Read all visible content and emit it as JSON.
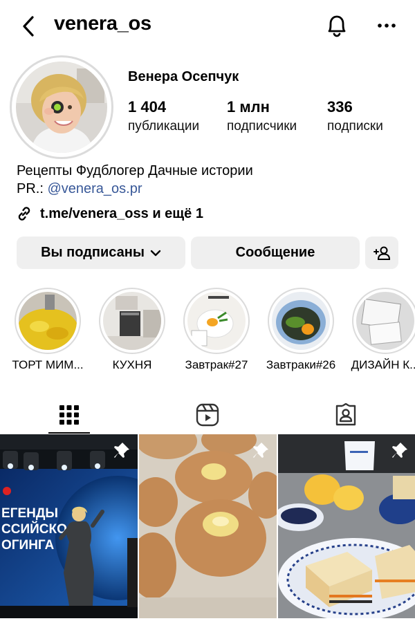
{
  "header": {
    "username": "venera_os",
    "icons": {
      "back": "chevron-left-icon",
      "notifications": "bell-icon",
      "more": "more-icon"
    }
  },
  "profile": {
    "full_name": "Венера Осепчук",
    "stats": [
      {
        "value": "1 404",
        "label": "публикации"
      },
      {
        "value": "1 млн",
        "label": "подписчики"
      },
      {
        "value": "336",
        "label": "подписки"
      }
    ],
    "bio_line1": "Рецепты Фудблогер Дачные истории",
    "bio_prefix": "PR.: ",
    "bio_mention": "@venera_os.pr",
    "link_text": "t.me/venera_oss и ещё 1",
    "mention_color": "#385898"
  },
  "actions": {
    "following_label": "Вы подписаны",
    "message_label": "Сообщение"
  },
  "highlights": [
    {
      "label": "ТОРТ МИМ..."
    },
    {
      "label": "КУХНЯ"
    },
    {
      "label": "Завтрак#27"
    },
    {
      "label": "Завтраки#26"
    },
    {
      "label": "ДИЗАЙН К..."
    }
  ],
  "tabs": {
    "active": "grid",
    "icons": [
      "grid-icon",
      "reels-icon",
      "tagged-icon"
    ]
  },
  "posts": [
    {
      "overlay_text": "ЛЕГЕНДЫ\nРОССИЙСКОГО\nБЛОГИНГА",
      "pinned": true
    },
    {
      "overlay_text": "",
      "pinned": true
    },
    {
      "overlay_text": "",
      "pinned": true
    }
  ]
}
